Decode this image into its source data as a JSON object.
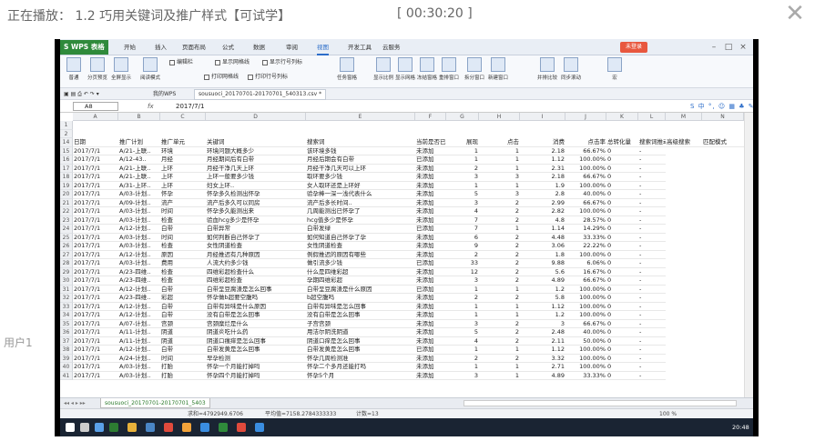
{
  "player": {
    "title": "正在播放： 1.2 巧用关键词及推广样式【可试学】",
    "time": "[ 00:30:20 ]",
    "close_icon": "close-icon",
    "user_label": "用户1"
  },
  "wps": {
    "app_name": "S WPS 表格",
    "menu": [
      "开始",
      "插入",
      "页面布局",
      "公式",
      "数据",
      "审阅",
      "视图",
      "开发工具",
      "云服务"
    ],
    "active_menu": "视图",
    "login_label": "未登录",
    "ribbon": {
      "buttons": [
        "普通",
        "分页预览",
        "全屏显示",
        "阅读模式",
        "任务窗格",
        "显示比例",
        "显示网格",
        "冻结窗格",
        "重排窗口",
        "拆分窗口",
        "新建窗口",
        "并排比较",
        "同步滚动",
        "宏"
      ],
      "checkboxes": [
        "编辑栏",
        "显示网格线",
        "显示行号列标",
        "打印网格线",
        "打印行号列标"
      ]
    },
    "quick_access": {
      "my_wps": "我的WPS",
      "file_tab": "sousuoci_20170701-20170701_540313.csv *"
    },
    "formula_bar": {
      "name_box": "A8",
      "fx": "fx",
      "value": "2017/7/1",
      "tools": "S 中 °, ☺ ▦ ♣ ✎ ⚒"
    },
    "columns": [
      "A",
      "B",
      "C",
      "D",
      "E",
      "F",
      "G",
      "H",
      "I",
      "J",
      "K",
      "L",
      "M",
      "N"
    ],
    "header_row": {
      "row": "14",
      "cells": [
        "日期",
        "推广计划",
        "推广单元",
        "关键词",
        "搜索词",
        "当前是否已",
        "展现",
        "点击",
        "消费",
        "点击率",
        "总转化量",
        "搜索词推动",
        "高级搜索",
        "匹配模式"
      ]
    },
    "first_rows": [
      "1",
      "2"
    ],
    "rows": [
      {
        "n": "15",
        "c": [
          "2017/7/1",
          "A/21-上联..",
          "环境",
          "环境问题大概多少",
          "该环境多钱",
          "未添加",
          "1",
          "1",
          "2.18",
          "66.67%",
          "0",
          "-"
        ]
      },
      {
        "n": "16",
        "c": [
          "2017/7/1",
          "A/12-43..",
          "月经",
          "月经期间后有白带",
          "月经后期会有白带",
          "已添加",
          "1",
          "1",
          "1.12",
          "100.00%",
          "0",
          "-"
        ]
      },
      {
        "n": "17",
        "c": [
          "2017/7/1",
          "A/21-上联..",
          "上环",
          "月经干净几天上环",
          "月经干净几天可以上环",
          "未添加",
          "2",
          "1",
          "2.31",
          "100.00%",
          "0",
          "-"
        ]
      },
      {
        "n": "18",
        "c": [
          "2017/7/1",
          "A/21-上联..",
          "上环",
          "上环一般要多少钱",
          "取环要多少钱",
          "未添加",
          "3",
          "3",
          "2.18",
          "66.67%",
          "0",
          "-"
        ]
      },
      {
        "n": "19",
        "c": [
          "2017/7/1",
          "A/31-上环..",
          "上环",
          "妇女上环..",
          "女人取环还是上环好",
          "未添加",
          "1",
          "1",
          "1.9",
          "100.00%",
          "0",
          "-"
        ]
      },
      {
        "n": "20",
        "c": [
          "2017/7/1",
          "A/03-计划..",
          "怀孕",
          "怀孕多久检测出怀孕",
          "验孕棒一深一浅代表什么",
          "未添加",
          "5",
          "3",
          "2.8",
          "40.00%",
          "0",
          "-"
        ]
      },
      {
        "n": "21",
        "c": [
          "2017/7/1",
          "A/09-计划..",
          "流产",
          "流产后多久可以同房",
          "流产后多长时间..",
          "未添加",
          "3",
          "2",
          "2.99",
          "66.67%",
          "0",
          "-"
        ]
      },
      {
        "n": "22",
        "c": [
          "2017/7/1",
          "A/03-计划..",
          "时间",
          "怀孕多久能测出来",
          "几周能测出已怀孕了",
          "未添加",
          "4",
          "2",
          "2.82",
          "100.00%",
          "0",
          "-"
        ]
      },
      {
        "n": "23",
        "c": [
          "2017/7/1",
          "A/03-计划..",
          "检查",
          "验血hcg多少是怀孕",
          "hcg值多少是怀孕",
          "未添加",
          "7",
          "2",
          "4.8",
          "28.57%",
          "0",
          "-"
        ]
      },
      {
        "n": "24",
        "c": [
          "2017/7/1",
          "A/12-计划..",
          "白带",
          "白带异常",
          "白带发绿",
          "已添加",
          "7",
          "1",
          "1.14",
          "14.29%",
          "0",
          "-"
        ]
      },
      {
        "n": "25",
        "c": [
          "2017/7/1",
          "A/03-计划..",
          "时间",
          "如何判断自己怀孕了",
          "如何知道自己怀孕了孕",
          "未添加",
          "6",
          "2",
          "4.48",
          "33.33%",
          "0",
          "-"
        ]
      },
      {
        "n": "26",
        "c": [
          "2017/7/1",
          "A/03-计划..",
          "检查",
          "女性阴道检查",
          "女性阴道检查",
          "未添加",
          "9",
          "2",
          "3.06",
          "22.22%",
          "0",
          "-"
        ]
      },
      {
        "n": "27",
        "c": [
          "2017/7/1",
          "A/12-计划..",
          "原因",
          "月经推迟有几种原因",
          "例假推迟的原因有哪些",
          "未添加",
          "2",
          "2",
          "1.8",
          "100.00%",
          "0",
          "-"
        ]
      },
      {
        "n": "28",
        "c": [
          "2017/7/1",
          "A/03-计划..",
          "费用",
          "人流大约多少钱",
          "做引流多少钱",
          "已添加",
          "33",
          "2",
          "9.88",
          "6.06%",
          "0",
          "-"
        ]
      },
      {
        "n": "29",
        "c": [
          "2017/7/1",
          "A/23-四维..",
          "检查",
          "四维彩超检查什么",
          "什么是四维彩超",
          "未添加",
          "12",
          "2",
          "5.6",
          "16.67%",
          "0",
          "-"
        ]
      },
      {
        "n": "30",
        "c": [
          "2017/7/1",
          "A/23-四维..",
          "检查",
          "四维彩超检查",
          "孕期四维彩超",
          "未添加",
          "3",
          "2",
          "4.89",
          "66.67%",
          "0",
          "-"
        ]
      },
      {
        "n": "31",
        "c": [
          "2017/7/1",
          "A/12-计划..",
          "白带",
          "白带呈豆腐渣是怎么回事",
          "白带呈豆腐渣是什么原因",
          "已添加",
          "1",
          "1",
          "1.2",
          "100.00%",
          "0",
          "-"
        ]
      },
      {
        "n": "32",
        "c": [
          "2017/7/1",
          "A/23-四维..",
          "彩超",
          "怀孕做b超要空腹吗",
          "b超空腹吗",
          "未添加",
          "2",
          "2",
          "5.8",
          "100.00%",
          "0",
          "-"
        ]
      },
      {
        "n": "33",
        "c": [
          "2017/7/1",
          "A/12-计划..",
          "白带",
          "白带有异味是什么原因",
          "白带有异味是怎么回事",
          "未添加",
          "1",
          "1",
          "1.12",
          "100.00%",
          "0",
          "-"
        ]
      },
      {
        "n": "34",
        "c": [
          "2017/7/1",
          "A/12-计划..",
          "白带",
          "没有白带是怎么回事",
          "没有白带是怎么回事",
          "未添加",
          "1",
          "1",
          "1.2",
          "100.00%",
          "0",
          "-"
        ]
      },
      {
        "n": "35",
        "c": [
          "2017/7/1",
          "A/07-计划..",
          "宫颈",
          "宫颈糜烂是什么",
          "子宫宫颈",
          "未添加",
          "3",
          "2",
          "3",
          "66.67%",
          "0",
          "-"
        ]
      },
      {
        "n": "36",
        "c": [
          "2017/7/1",
          "A/11-计划..",
          "阴道",
          "阴道炎吃什么药",
          "用洁尔阴洗阴道",
          "未添加",
          "5",
          "2",
          "2.48",
          "40.00%",
          "0",
          "-"
        ]
      },
      {
        "n": "37",
        "c": [
          "2017/7/1",
          "A/11-计划..",
          "阴道",
          "阴道口瘙痒是怎么回事",
          "阴道口痒是怎么回事",
          "未添加",
          "4",
          "2",
          "2.11",
          "50.00%",
          "0",
          "-"
        ]
      },
      {
        "n": "38",
        "c": [
          "2017/7/1",
          "A/12-计划..",
          "白带",
          "白带发黄是怎么回事",
          "白带发黄是怎么回事",
          "已添加",
          "1",
          "1",
          "1.12",
          "100.00%",
          "0",
          "-"
        ]
      },
      {
        "n": "39",
        "c": [
          "2017/7/1",
          "A/24-计划..",
          "时间",
          "早孕检测",
          "怀孕几周检测准",
          "未添加",
          "2",
          "2",
          "3.32",
          "100.00%",
          "0",
          "-"
        ]
      },
      {
        "n": "40",
        "c": [
          "2017/7/1",
          "A/03-计划..",
          "打胎",
          "怀孕一个月能打掉吗",
          "怀孕二个多月还能打吗",
          "未添加",
          "1",
          "1",
          "2.71",
          "100.00%",
          "0",
          "-"
        ]
      },
      {
        "n": "41",
        "c": [
          "2017/7/1",
          "A/03-计划..",
          "打胎",
          "怀孕四个月能打掉吗",
          "怀孕5个月",
          "未添加",
          "3",
          "1",
          "4.89",
          "33.33%",
          "0",
          "-"
        ]
      }
    ],
    "sheet_tab": "sousuoci_20170701-20170701_5403",
    "status": {
      "sum": "求和=4792949.6706",
      "avg": "平均值=7158.2784333333",
      "count": "计数=13",
      "zoom": "100 %"
    },
    "clock": "20:48"
  }
}
